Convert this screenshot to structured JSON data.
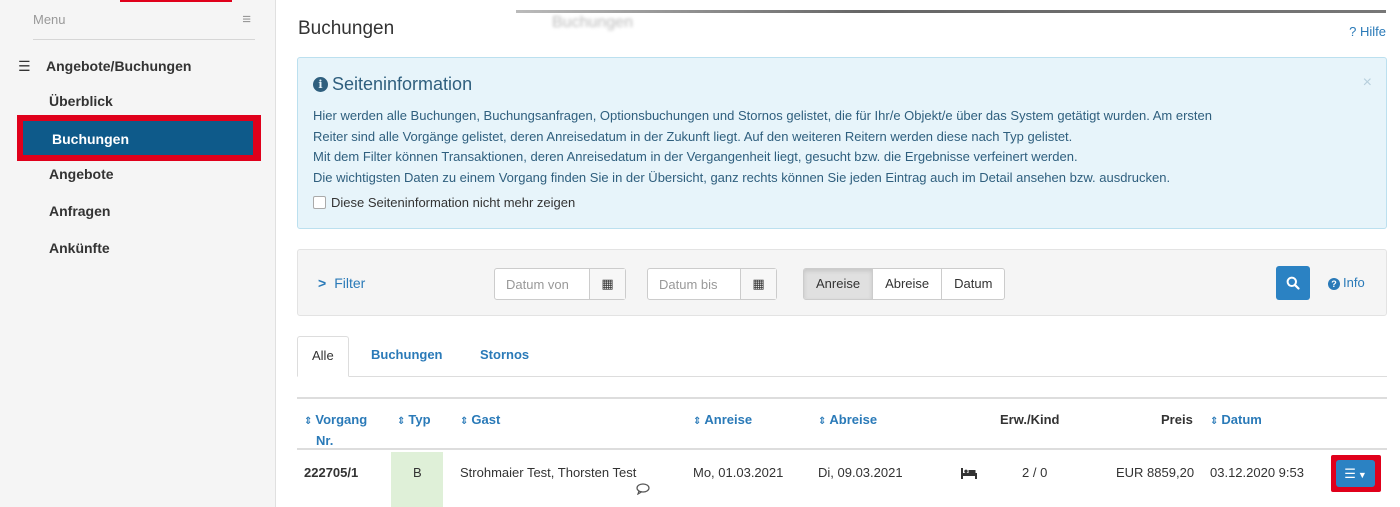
{
  "sidebar": {
    "menu_label": "Menu",
    "section_label": "Angebote/Buchungen",
    "items": [
      {
        "label": "Überblick"
      },
      {
        "label": "Buchungen",
        "active": true
      },
      {
        "label": "Angebote"
      },
      {
        "label": "Anfragen"
      },
      {
        "label": "Ankünfte"
      }
    ]
  },
  "header": {
    "title": "Buchungen",
    "ghost_title": "Buchungen",
    "help_label": "? Hilfe"
  },
  "info": {
    "title": "Seiteninformation",
    "close": "×",
    "lines": [
      "Hier werden alle Buchungen, Buchungsanfragen, Optionsbuchungen und Stornos gelistet, die für Ihr/e Objekt/e über das System getätigt wurden. Am ersten",
      "Reiter sind alle Vorgänge gelistet, deren Anreisedatum in der Zukunft liegt. Auf den weiteren Reitern werden diese nach Typ gelistet.",
      "Mit dem Filter können Transaktionen, deren Anreisedatum in der Vergangenheit liegt, gesucht bzw. die Ergebnisse verfeinert werden.",
      "Die wichtigsten Daten zu einem Vorgang finden Sie in der Übersicht, ganz rechts können Sie jeden Eintrag auch im Detail ansehen bzw. ausdrucken."
    ],
    "checkbox_label": "Diese Seiteninformation nicht mehr zeigen"
  },
  "filter": {
    "toggle_label": "Filter",
    "date_from_placeholder": "Datum von",
    "date_to_placeholder": "Datum bis",
    "segments": [
      "Anreise",
      "Abreise",
      "Datum"
    ],
    "active_segment": "Anreise",
    "info_label": "Info"
  },
  "tabs": [
    {
      "label": "Alle",
      "active": true
    },
    {
      "label": "Buchungen"
    },
    {
      "label": "Stornos"
    }
  ],
  "table": {
    "headers": {
      "vorgang_line1": "Vorgang",
      "vorgang_line2": "Nr.",
      "typ": "Typ",
      "gast": "Gast",
      "anreise": "Anreise",
      "abreise": "Abreise",
      "erwkind": "Erw./Kind",
      "preis": "Preis",
      "datum": "Datum"
    },
    "rows": [
      {
        "vorgang": "222705/1",
        "typ": "B",
        "gast": "Strohmaier Test, Thorsten Test",
        "anreise": "Mo, 01.03.2021",
        "abreise": "Di, 09.03.2021",
        "erwkind": "2 / 0",
        "preis": "EUR 8859,20",
        "datum": "03.12.2020 9:53"
      }
    ]
  },
  "colors": {
    "accent": "#2b82c3",
    "active_nav": "#0e5a8a",
    "highlight": "#e0001b",
    "type_booking_bg": "#dff0d8"
  }
}
